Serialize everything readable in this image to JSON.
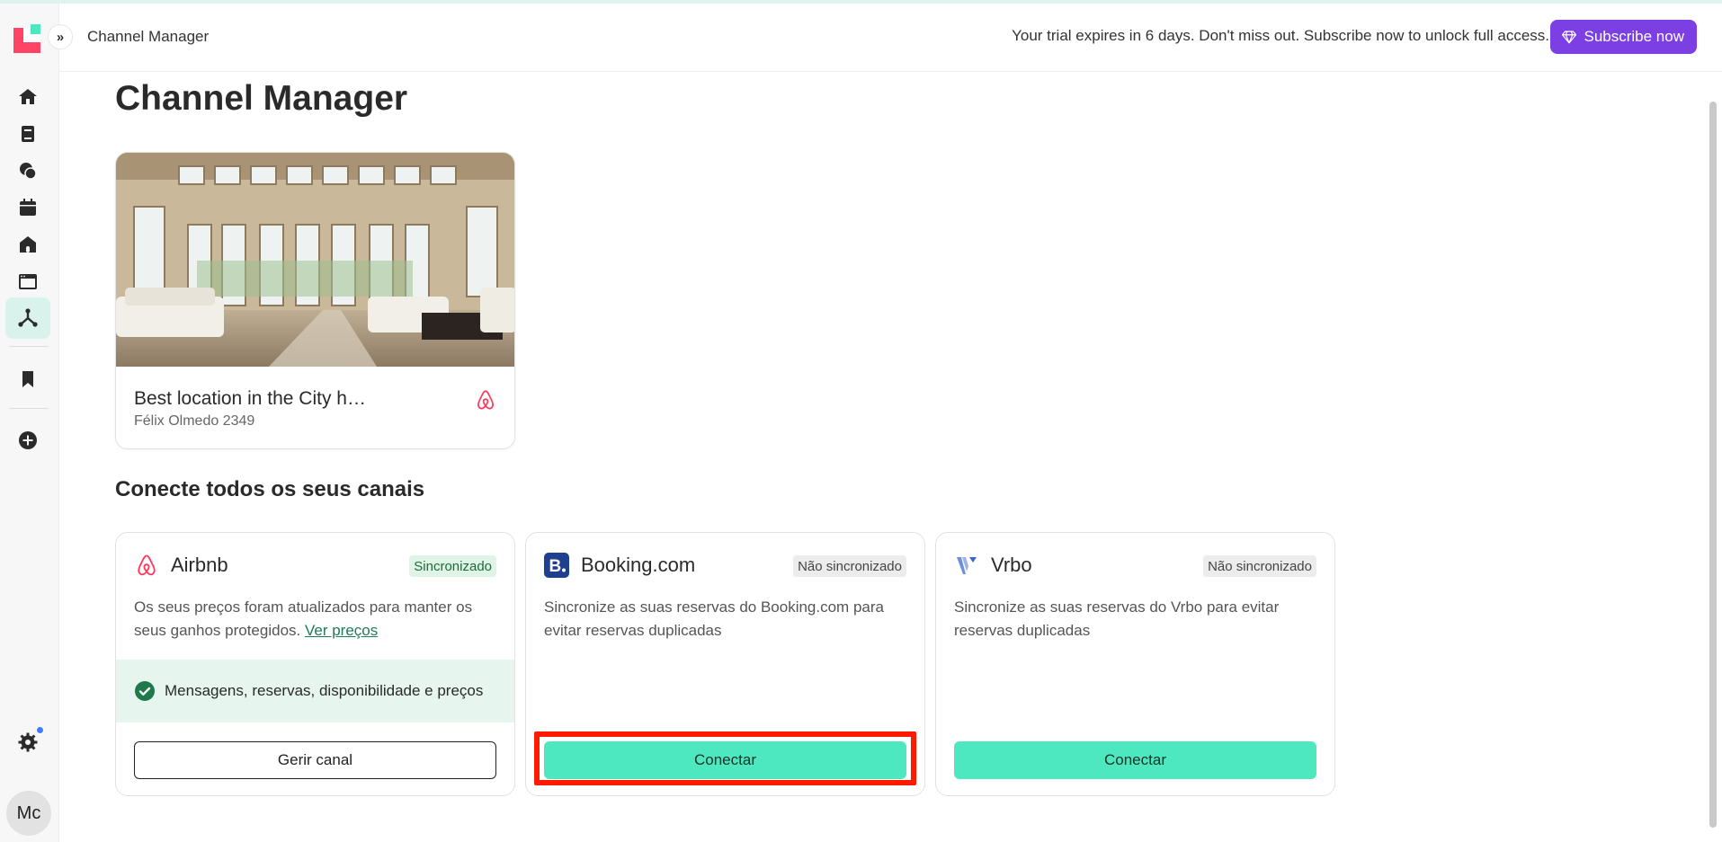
{
  "header": {
    "breadcrumb": "Channel Manager",
    "trial_text": "Your trial expires in 6 days. Don't miss out. Subscribe now to unlock full access.",
    "subscribe_label": "Subscribe now",
    "subscribe_icon": "diamond-icon"
  },
  "sidebar": {
    "expand_icon": "double-chevron-right-icon",
    "items": [
      {
        "name": "home-icon",
        "active": false
      },
      {
        "name": "book-icon",
        "active": false
      },
      {
        "name": "chat-icon",
        "active": false
      },
      {
        "name": "calendar-icon",
        "active": false
      },
      {
        "name": "house-icon",
        "active": false
      },
      {
        "name": "browser-icon",
        "active": false
      },
      {
        "name": "channel-manager-icon",
        "active": true
      },
      {
        "name": "bookmark-icon",
        "active": false
      },
      {
        "name": "add-circle-icon",
        "active": false
      },
      {
        "name": "settings-icon",
        "active": false
      }
    ],
    "avatar_initials": "Mc"
  },
  "page": {
    "title": "Channel Manager"
  },
  "property": {
    "name": "Best location in the City h…",
    "address": "Félix Olmedo 2349"
  },
  "channels_section": {
    "title": "Conecte todos os seus canais",
    "channels": [
      {
        "name": "Airbnb",
        "status": "Sincronizado",
        "description": "Os seus preços foram atualizados para manter os seus ganhos protegidos.",
        "link": "Ver preços",
        "sync_features": "Mensagens, reservas, disponibilidade e preços",
        "button": "Gerir canal"
      },
      {
        "name": "Booking.com",
        "status": "Não sincronizado",
        "description": "Sincronize as suas reservas do Booking.com para evitar reservas duplicadas",
        "button": "Conectar"
      },
      {
        "name": "Vrbo",
        "status": "Não sincronizado",
        "description": "Sincronize as suas reservas do Vrbo para evitar reservas duplicadas",
        "button": "Conectar"
      }
    ]
  },
  "colors": {
    "accent_green": "#4ee8c0",
    "subscribe_purple": "#7b3fe4",
    "highlight_red": "#ff1a00",
    "airbnb_red": "#ff385c",
    "booking_blue": "#1f3f8f"
  }
}
